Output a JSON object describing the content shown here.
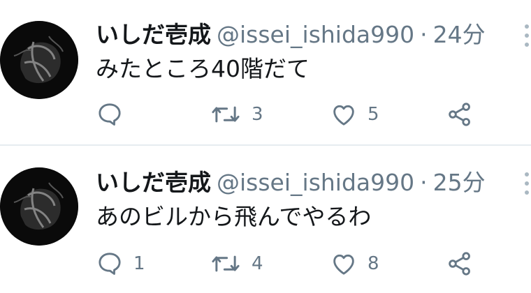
{
  "tweets": [
    {
      "name": "いしだ壱成",
      "handle": "@issei_ishida990",
      "separator": "·",
      "time": "24分",
      "text": "みたところ40階だて",
      "reply_count": "",
      "retweet_count": "3",
      "like_count": "5"
    },
    {
      "name": "いしだ壱成",
      "handle": "@issei_ishida990",
      "separator": "·",
      "time": "25分",
      "text": "あのビルから飛んでやるわ",
      "reply_count": "1",
      "retweet_count": "4",
      "like_count": "8"
    }
  ],
  "colors": {
    "text": "#14171a",
    "secondary": "#657786",
    "divider": "#e6ecf0",
    "icon": "#657786"
  },
  "icons": [
    "reply-icon",
    "retweet-icon",
    "like-icon",
    "share-icon",
    "more-icon"
  ]
}
